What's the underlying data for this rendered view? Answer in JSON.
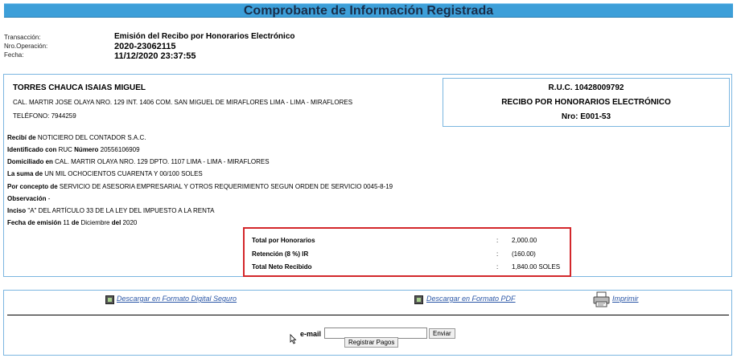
{
  "title": "Comprobante de Información Registrada",
  "meta": {
    "labels": [
      "Transacción:",
      "Nro.Operación:",
      "Fecha:"
    ],
    "transaction": "Emisión del Recibo por Honorarios Electrónico",
    "operation": "2020-23062115",
    "date": "11/12/2020 23:37:55"
  },
  "issuer": {
    "name": "TORRES CHAUCA ISAIAS MIGUEL",
    "address": "CAL. MARTIR JOSE OLAYA NRO. 129 INT. 1406 COM. SAN MIGUEL DE MIRAFLORES LIMA - LIMA - MIRAFLORES",
    "phone": "TELÉFONO: 7944259"
  },
  "receipt_box": {
    "ruc": "R.U.C. 10428009792",
    "type": "RECIBO POR HONORARIOS ELECTRÓNICO",
    "number": "Nro: E001-53"
  },
  "details": {
    "recibi_label": "Recibí de",
    "recibi_value": "NOTICIERO DEL CONTADOR S.A.C.",
    "id_label": "Identificado con",
    "id_type": "RUC",
    "id_num_label": "Número",
    "id_value": "20556106909",
    "dom_label": "Domiciliado en",
    "dom_value": "CAL. MARTIR OLAYA NRO. 129 DPTO. 1107 LIMA - LIMA - MIRAFLORES",
    "suma_label": "La suma de",
    "suma_value": "UN MIL OCHOCIENTOS CUARENTA Y 00/100 SOLES",
    "concepto_label": "Por concepto de",
    "concepto_value": "SERVICIO DE ASESORIA EMPRESARIAL Y OTROS REQUERIMIENTO SEGUN ORDEN DE SERVICIO 0045-8-19",
    "obs_label": "Observación",
    "obs_value": "-",
    "inciso_label": "Inciso",
    "inciso_value": "\"A\" DEL ARTÍCULO 33 DE LA LEY DEL IMPUESTO A LA RENTA",
    "fecha_label": "Fecha de emisión",
    "fecha_day": "11",
    "fecha_de1": "de",
    "fecha_month": "Diciembre",
    "fecha_del": "del",
    "fecha_year": "2020"
  },
  "totals": [
    {
      "label": "Total por Honorarios",
      "colon": ":",
      "value": "2,000.00"
    },
    {
      "label": "Retención (8 %) IR",
      "colon": ":",
      "value": "(160.00)"
    },
    {
      "label": "Total Neto Recibido",
      "colon": ":",
      "value": "1,840.00 SOLES"
    }
  ],
  "actions": {
    "download_secure": "Descargar en Formato Digital Seguro",
    "download_pdf": "Descargar en Formato PDF",
    "print": "Imprimir",
    "email_label": "e-mail",
    "email_value": "",
    "send_button": "Enviar",
    "register_button": "Registrar Pagos"
  },
  "colors": {
    "title_bar": "#3d9fd9",
    "box_border": "#7bb6e0",
    "highlight_border": "#d3272b",
    "link": "#2a56a6"
  }
}
